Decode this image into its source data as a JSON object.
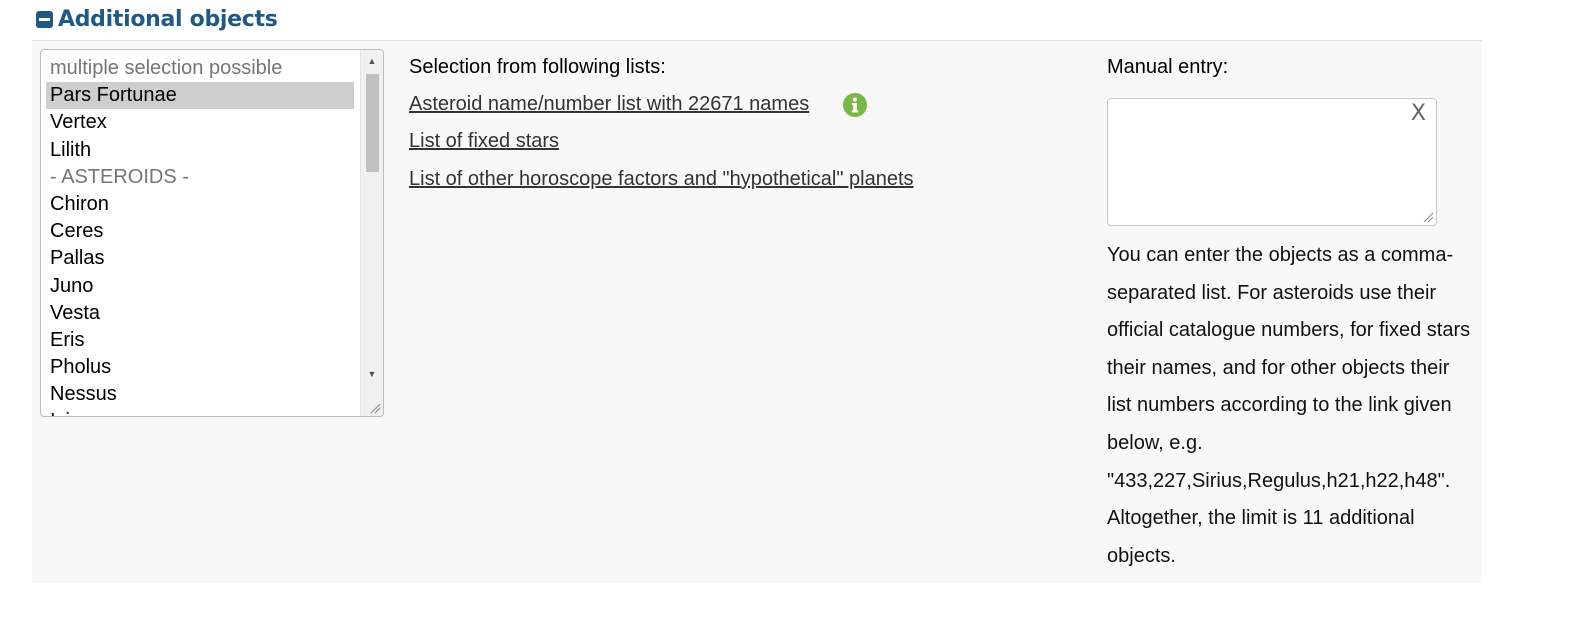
{
  "section": {
    "title": "Additional objects"
  },
  "listbox": {
    "placeholder": "multiple selection possible",
    "items": [
      {
        "label": "Pars Fortunae",
        "selected": true
      },
      {
        "label": "Vertex"
      },
      {
        "label": "Lilith"
      },
      {
        "label": "- ASTEROIDS -",
        "group": true
      },
      {
        "label": "Chiron"
      },
      {
        "label": "Ceres"
      },
      {
        "label": "Pallas"
      },
      {
        "label": "Juno"
      },
      {
        "label": "Vesta"
      },
      {
        "label": "Eris"
      },
      {
        "label": "Pholus"
      },
      {
        "label": "Nessus"
      },
      {
        "label": "Ixion"
      }
    ]
  },
  "lists": {
    "title": "Selection from following lists:",
    "asteroid_link": "Asteroid name/number list with 22671 names",
    "fixed_stars_link": "List of fixed stars",
    "other_link": "List of other horoscope factors and \"hypothetical\" planets"
  },
  "manual": {
    "label": "Manual entry:",
    "value": "",
    "clear_label": "X",
    "help_text": "You can enter the objects as a comma-separated list. For asteroids use their official catalogue numbers, for fixed stars their names, and for other objects their list numbers according to the link given below, e.g. \"433,227,Sirius,Regulus,h21,h22,h48\". Altogether, the limit is 11 additional objects."
  },
  "colors": {
    "header_blue": "#1f5a86",
    "info_green": "#7ab648",
    "panel_bg": "#f8f8f8",
    "selected_bg": "#cecece"
  },
  "icons": {
    "collapse": "minus-square-icon",
    "info": "info-circle-icon"
  }
}
